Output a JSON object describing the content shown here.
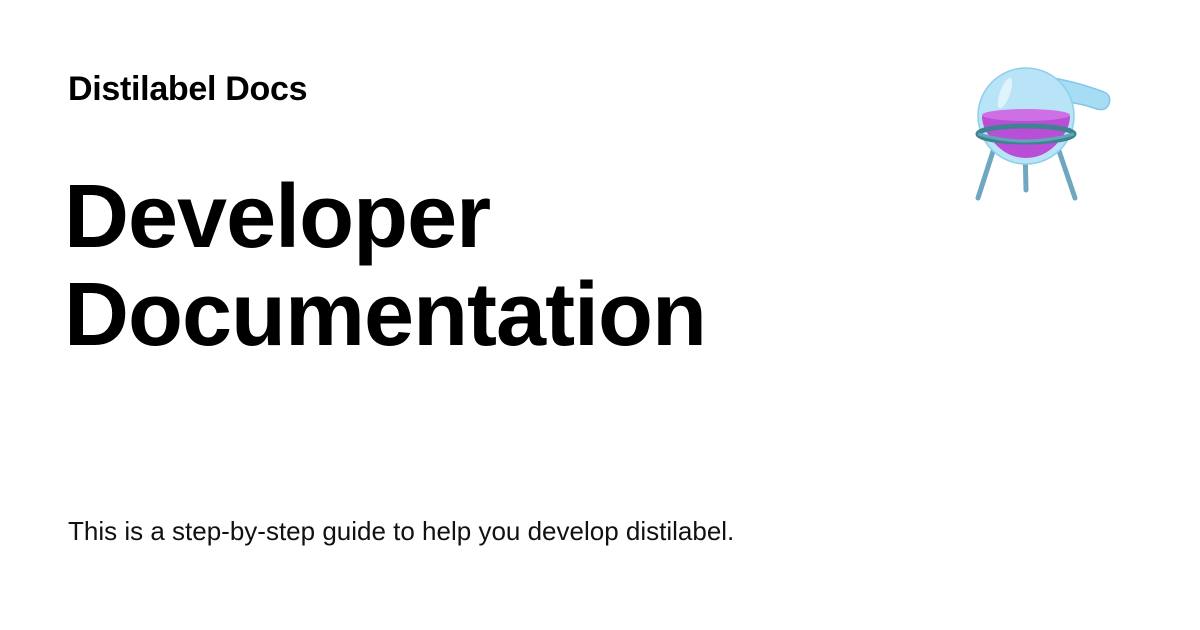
{
  "site": {
    "name": "Distilabel Docs"
  },
  "page": {
    "title_line_1": "Developer",
    "title_line_2": "Documentation",
    "description": "This is a step-by-step guide to help you develop distilabel."
  },
  "logo": {
    "icon": "distilabel-flask-icon"
  },
  "colors": {
    "background": "#ffffff",
    "text": "#000000",
    "flask_glass": "#a6dcf4",
    "flask_liquid": "#b84fd6",
    "stand": "#6fa7c0"
  }
}
